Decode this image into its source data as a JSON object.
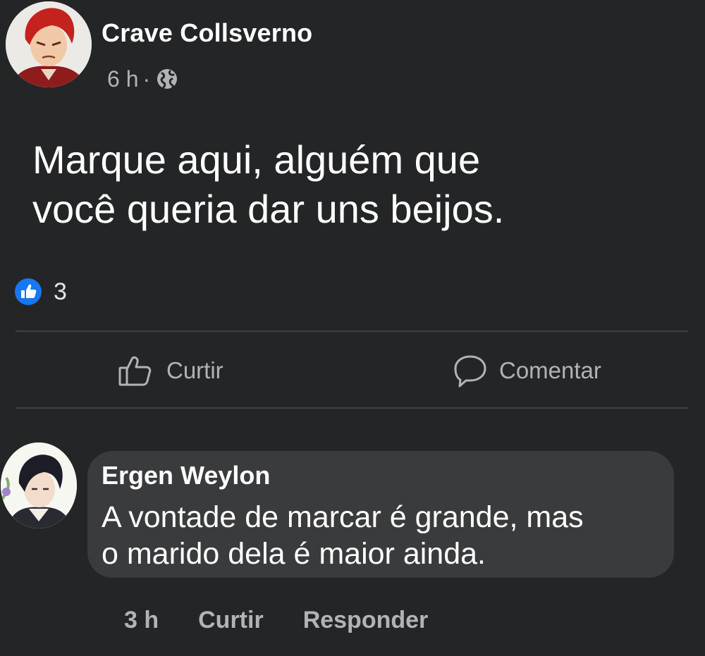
{
  "post": {
    "author": "Crave Collsverno",
    "time": "6 h",
    "separator": "·",
    "audience_icon": "globe-icon",
    "text_line1": "Marque aqui, alguém que",
    "text_line2": "você queria dar uns beijos.",
    "reaction_icon": "like-reaction-icon",
    "reaction_count": "3"
  },
  "actions": {
    "like_label": "Curtir",
    "like_icon": "thumbs-up-icon",
    "comment_label": "Comentar",
    "comment_icon": "speech-bubble-icon"
  },
  "comment": {
    "author": "Ergen Weylon",
    "text_line1": "A vontade de marcar é grande, mas",
    "text_line2": "o marido dela é maior ainda.",
    "time": "3 h",
    "like_label": "Curtir",
    "reply_label": "Responder"
  },
  "colors": {
    "background": "#242526",
    "bubble": "#3a3b3c",
    "secondary_text": "#b0b3b8",
    "like_blue": "#1877f2"
  }
}
